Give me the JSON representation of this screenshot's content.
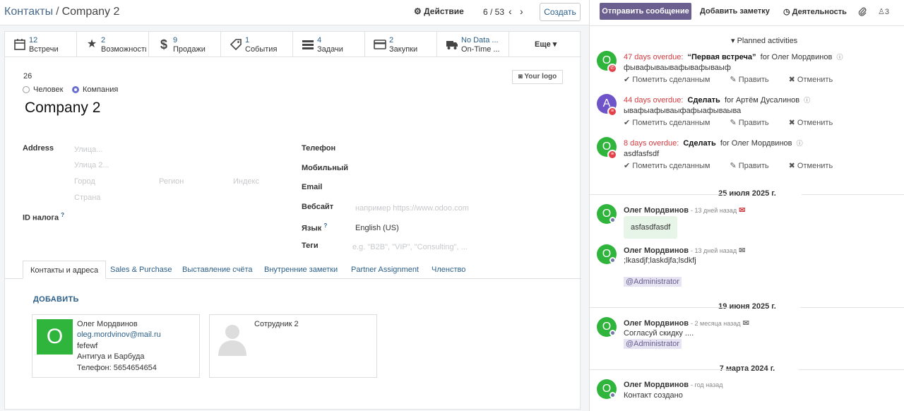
{
  "breadcrumb": {
    "parent": "Контакты",
    "separator": "/",
    "current": "Company 2"
  },
  "toolbar": {
    "action_label": "Действие",
    "pager": "6 / 53",
    "create_label": "Создать"
  },
  "smart_buttons": [
    {
      "icon": "calendar-icon",
      "count": "12",
      "label": "Встречи"
    },
    {
      "icon": "star-icon",
      "count": "2",
      "label": "Возможности"
    },
    {
      "icon": "dollar-icon",
      "count": "9",
      "label": "Продажи"
    },
    {
      "icon": "tag-icon",
      "count": "1",
      "label": "События"
    },
    {
      "icon": "tasks-icon",
      "count": "4",
      "label": "Задачи"
    },
    {
      "icon": "credit-card-icon",
      "count": "2",
      "label": "Закупки"
    },
    {
      "icon": "truck-icon",
      "count": "No Data ...",
      "label": "On-Time ..."
    }
  ],
  "more_label": "Еще",
  "form": {
    "ref": "26",
    "type_person": "Человек",
    "type_company": "Компания",
    "name": "Company 2",
    "logo_label": "Your logo",
    "address_label": "Address",
    "street_ph": "Улица...",
    "street2_ph": "Улица 2...",
    "city_ph": "Город",
    "state_ph": "Регион",
    "zip_ph": "Индекс",
    "country_ph": "Страна",
    "vat_label": "ID налога",
    "phone_label": "Телефон",
    "mobile_label": "Мобильный",
    "email_label": "Email",
    "website_label": "Вебсайт",
    "website_ph": "например https://www.odoo.com",
    "lang_label": "Язык",
    "lang_value": "English (US)",
    "tags_label": "Теги",
    "tags_ph": "e.g. \"B2B\", \"VIP\", \"Consulting\", ..."
  },
  "tabs": [
    "Контакты и адреса",
    "Sales & Purchase",
    "Выставление счёта",
    "Внутренние заметки",
    "Partner Assignment",
    "Членство"
  ],
  "add_label": "ДОБАВИТЬ",
  "contacts": [
    {
      "initial": "O",
      "name": "Олег Мордвинов",
      "email": "oleg.mordvinov@mail.ru",
      "note": "fefewf",
      "country": "Антигуа и Барбуда",
      "phone": "Телефон: 5654654654"
    },
    {
      "name": "Сотрудник 2"
    }
  ],
  "chatter": {
    "send_label": "Отправить сообщение",
    "note_label": "Добавить заметку",
    "activity_label": "Деятельность",
    "followers_count": "3",
    "planned_label": "Planned activities",
    "activities": [
      {
        "avatar": "O",
        "overdue": "47 days overdue:",
        "summary": "“Первая встреча”",
        "assignee": "for Олег Мордвинов",
        "note": "фывафываывафывафываыф"
      },
      {
        "avatar": "A",
        "overdue": "44 days overdue:",
        "summary": "Сделать",
        "assignee": "for Артём Дусалинов",
        "note": "ывафыафываыфафыафываыва"
      },
      {
        "avatar": "O",
        "overdue": "8 days overdue:",
        "summary": "Сделать",
        "assignee": "for Олег Мордвинов",
        "note": "asdfasfsdf"
      }
    ],
    "act_done": "Пометить сделанным",
    "act_edit": "Править",
    "act_cancel": "Отменить",
    "messages": [
      {
        "date": "25 июля 2025 г.",
        "author": "Олег Мордвинов",
        "ago": "- 13 дней назад",
        "body": "asfasdfasdf"
      },
      {
        "author": "Олег Мордвинов",
        "ago": "- 13 дней назад",
        "body": ";lkasdjf;laskdjfa;lsdkfj",
        "mention": "@Administrator"
      },
      {
        "date": "19 июня 2025 г.",
        "author": "Олег Мордвинов",
        "ago": "- 2 месяца назад",
        "body": "Согласуй скидку ....",
        "mention": "@Administrator"
      },
      {
        "date": "7 марта 2024 г.",
        "author": "Олег Мордвинов",
        "ago": "- год назад",
        "body": "Контакт создано"
      }
    ]
  }
}
